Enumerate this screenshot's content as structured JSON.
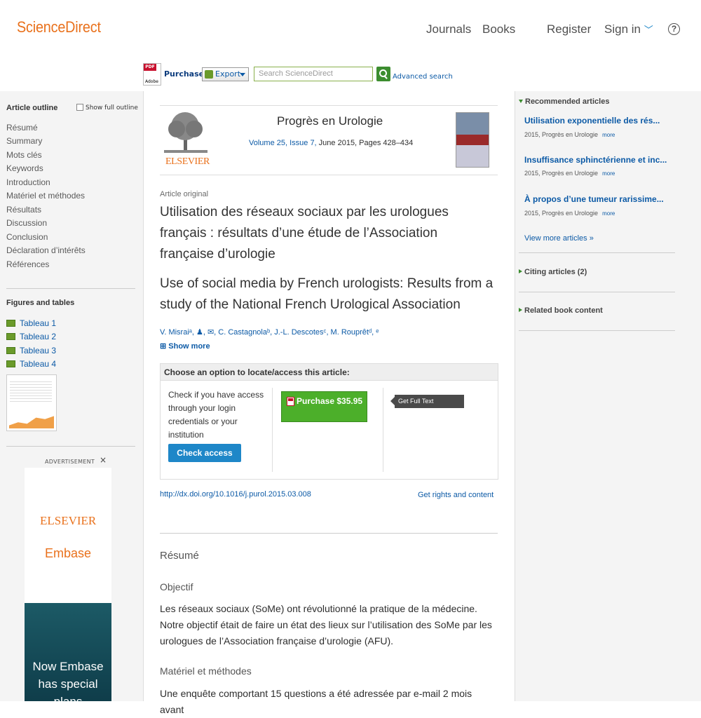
{
  "header": {
    "logo": "ScienceDirect",
    "nav": [
      "Journals",
      "Books",
      "Register",
      "Sign in"
    ],
    "help": "?"
  },
  "toolbar": {
    "pdf_badge": "PDF",
    "pdf_sub": "Adobe",
    "purchase": "Purchase",
    "export": "Export",
    "search_placeholder": "Search ScienceDirect",
    "advanced": "Advanced search"
  },
  "outline": {
    "title": "Article outline",
    "show_full": "Show full outline",
    "items": [
      "Résumé",
      "Summary",
      "Mots clés",
      "Keywords",
      "Introduction",
      "Matériel et méthodes",
      "Résultats",
      "Discussion",
      "Conclusion",
      "Déclaration d’intérêts",
      "Références"
    ]
  },
  "figures": {
    "title": "Figures and tables",
    "items": [
      "Tableau 1",
      "Tableau 2",
      "Tableau 3",
      "Tableau 4"
    ]
  },
  "ad": {
    "label": "ADVERTISEMENT",
    "close": "×",
    "elsevier": "ELSEVIER",
    "embase": "Embase",
    "text": "Now Embase has special plans"
  },
  "journal": {
    "name": "Progrès en Urologie",
    "volume": "Volume 25, Issue 7,",
    "date_pages": " June 2015, Pages 428–434",
    "elsevier": "ELSEVIER"
  },
  "article": {
    "type": "Article original",
    "title_fr": "Utilisation des réseaux sociaux par les urologues français : résultats d’une étude de l’Association française d’urologie",
    "title_en": "Use of social media by French urologists: Results from a study of the National French Urological Association",
    "authors": "V. Misraiᵃ, ♟, ✉, C. Castagnolaᵇ, J.-L. Descotesᶜ, M. Rouprêtᵈ, ᵉ",
    "show_more": "⊞ Show more",
    "doi": "http://dx.doi.org/10.1016/j.purol.2015.03.008",
    "rights": "Get rights and content"
  },
  "access": {
    "heading": "Choose an option to locate/access this article:",
    "check_text": "Check if you have access through your login credentials or your institution",
    "check_button": "Check access",
    "purchase_button": "Purchase $35.95",
    "elsewhere": "Get Full Text Elsewhere"
  },
  "abstract": {
    "heading": "Résumé",
    "obj_heading": "Objectif",
    "obj_text": "Les réseaux sociaux (SoMe) ont révolutionné la pratique de la médecine. Notre objectif était de faire un état des lieux sur l’utilisation des SoMe par les urologues de l’Association française d’urologie (AFU).",
    "mat_heading": "Matériel et méthodes",
    "mat_text": "Une enquête comportant 15 questions a été adressée par e-mail 2 mois avant"
  },
  "sidebar": {
    "recommended_title": "Recommended articles",
    "articles": [
      {
        "title": "Utilisation exponentielle des rés...",
        "meta": "2015, Progrès en Urologie",
        "more": "more"
      },
      {
        "title": "Insuffisance sphinctérienne et inc...",
        "meta": "2015, Progrès en Urologie",
        "more": "more"
      },
      {
        "title": "À propos d’une tumeur rarissime...",
        "meta": "2015, Progrès en Urologie",
        "more": "more"
      }
    ],
    "view_more": "View more articles »",
    "citing": "Citing articles (2)",
    "related": "Related book content"
  },
  "colors": {
    "brand": "#e9711c",
    "link": "#0c5aa6",
    "purchase_green": "#4caf2a",
    "check_blue": "#1e87c8"
  }
}
